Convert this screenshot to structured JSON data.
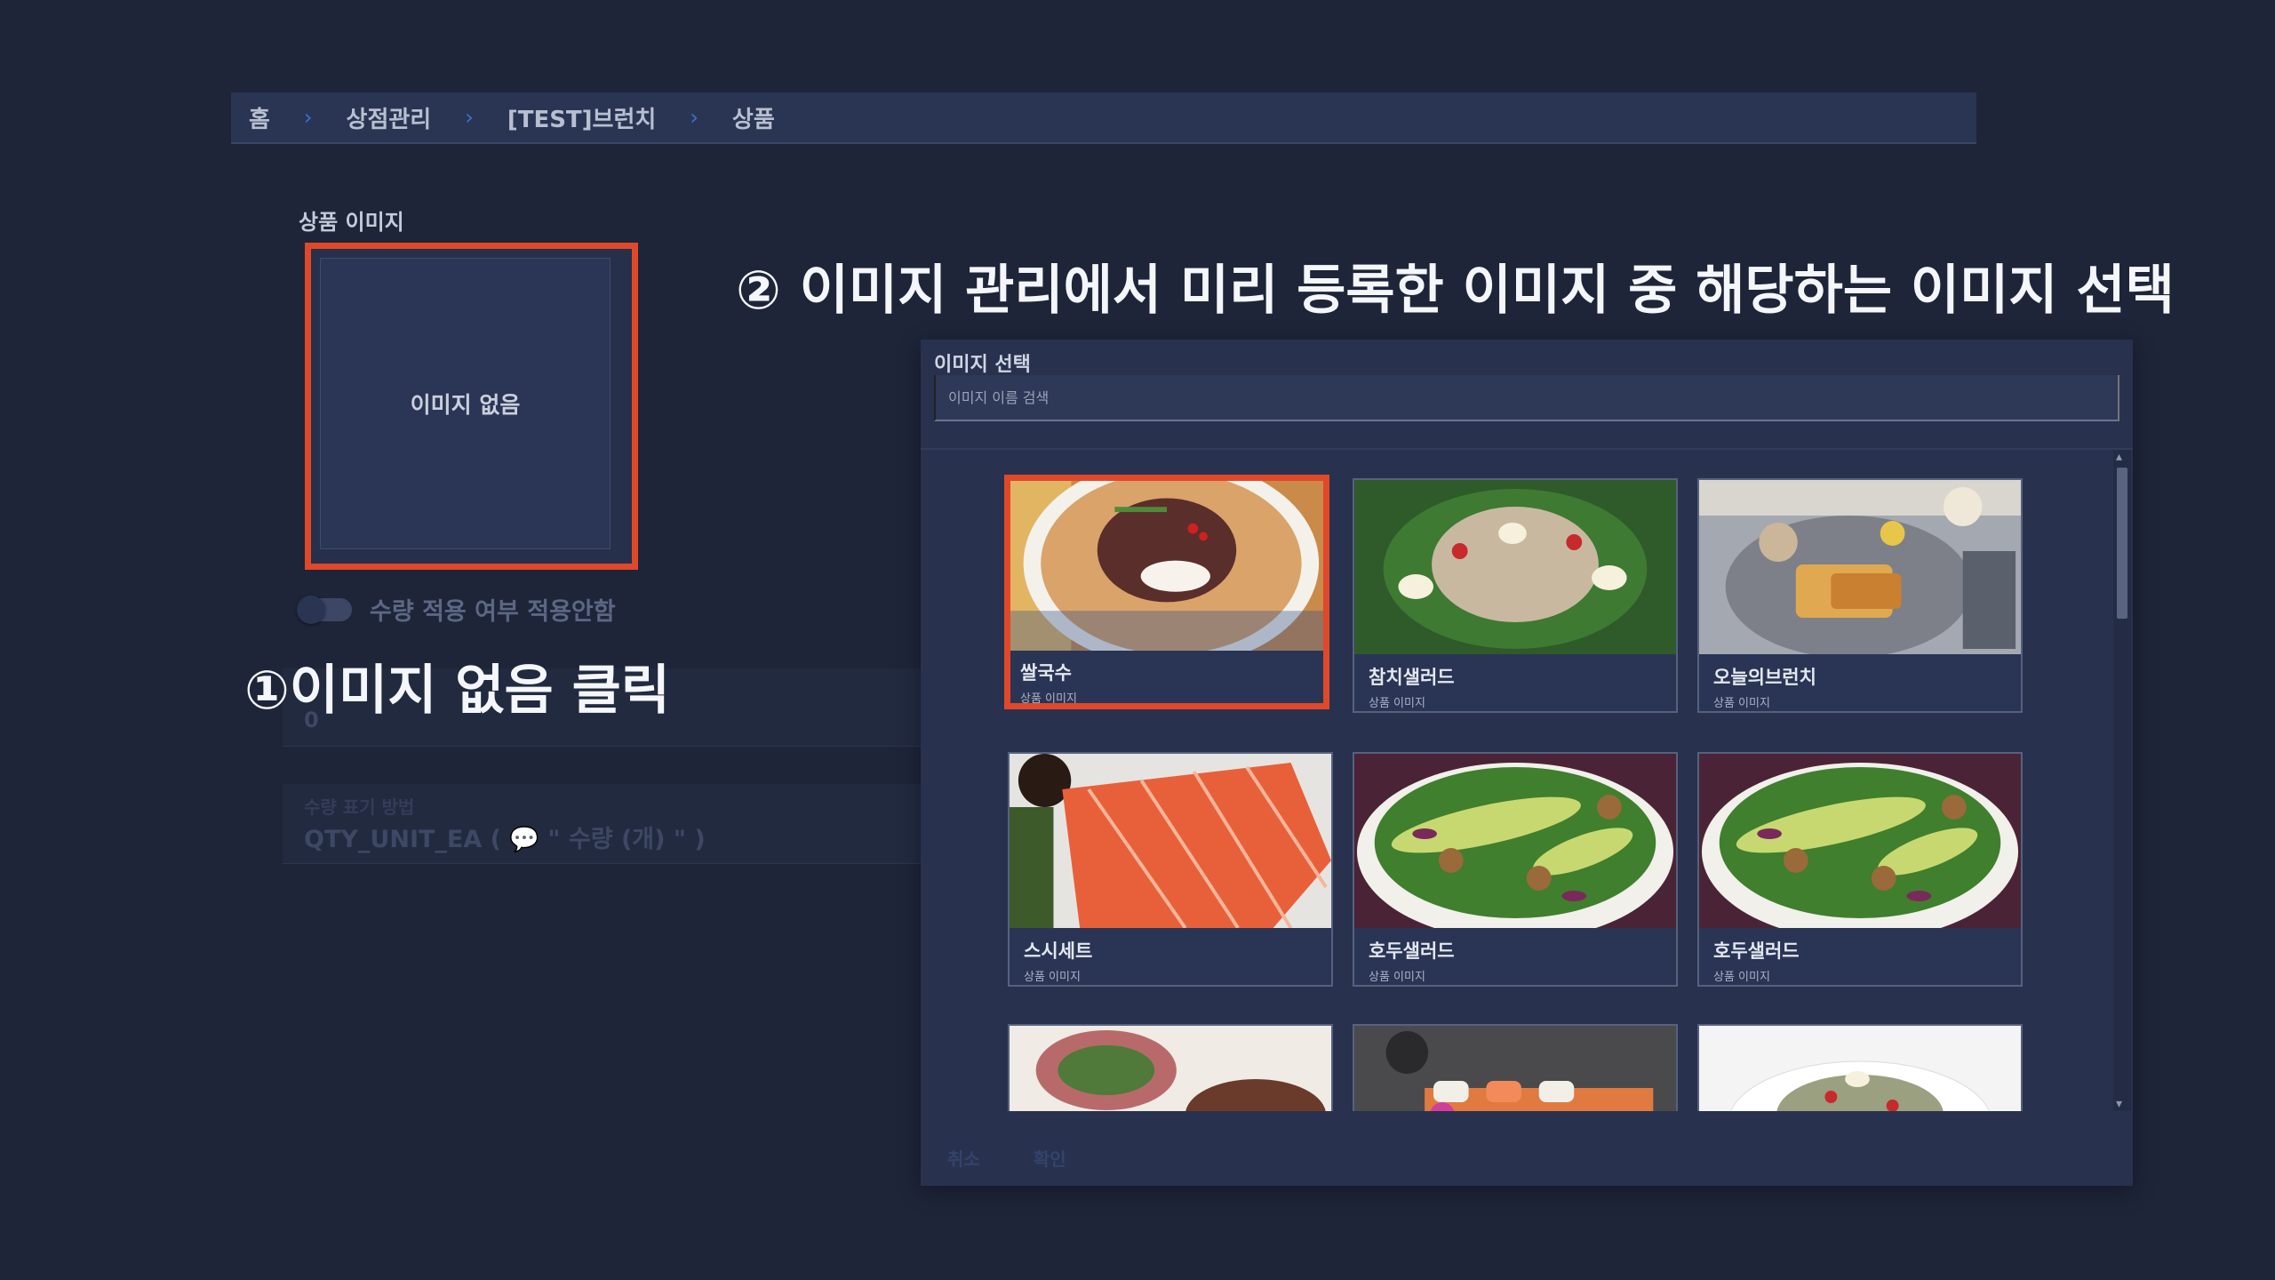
{
  "breadcrumb": {
    "items": [
      "홈",
      "상점관리",
      "[TEST]브런치",
      "상품"
    ],
    "separator": "›"
  },
  "product_image": {
    "section_label": "상품 이미지",
    "placeholder_text": "이미지 없음"
  },
  "quantity_toggle": {
    "label": "수량 적용 여부 적용안함",
    "enabled": false
  },
  "faded_fields": {
    "quantity_value": "0",
    "unit_label": "수량 표기 방법",
    "unit_value": "QTY_UNIT_EA ( 💬 \" 수량 (개) \" )"
  },
  "annotations": {
    "step1": "①이미지 없음 클릭",
    "step2": "② 이미지 관리에서 미리 등록한 이미지 중 해당하는 이미지 선택"
  },
  "dialog": {
    "title": "이미지 선택",
    "search_placeholder": "이미지 이름 검색",
    "cards": [
      {
        "name": "쌀국수",
        "sub": "상품 이미지",
        "selected": true
      },
      {
        "name": "참치샐러드",
        "sub": "상품 이미지",
        "selected": false
      },
      {
        "name": "오늘의브런치",
        "sub": "상품 이미지",
        "selected": false
      },
      {
        "name": "스시세트",
        "sub": "상품 이미지",
        "selected": false
      },
      {
        "name": "호두샐러드",
        "sub": "상품 이미지",
        "selected": false
      },
      {
        "name": "호두샐러드",
        "sub": "상품 이미지",
        "selected": false
      }
    ],
    "actions": {
      "cancel": "취소",
      "confirm": "확인"
    }
  },
  "colors": {
    "background": "#1e2539",
    "highlight": "#e0482a",
    "panel": "#28324f"
  }
}
